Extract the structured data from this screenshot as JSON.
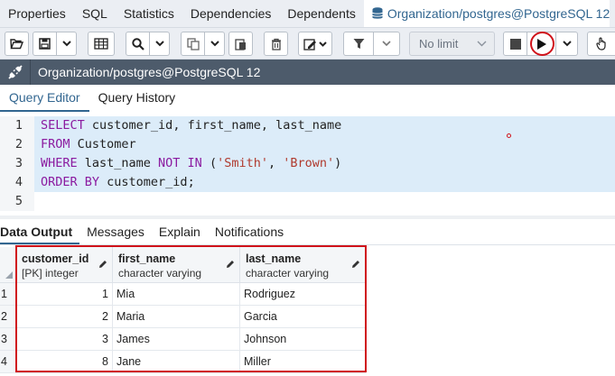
{
  "top_tabs": [
    {
      "label": "Properties"
    },
    {
      "label": "SQL"
    },
    {
      "label": "Statistics"
    },
    {
      "label": "Dependencies"
    },
    {
      "label": "Dependents"
    },
    {
      "label": "Organization/postgres@PostgreSQL 12",
      "active": true
    }
  ],
  "toolbar": {
    "limit_select": "No limit"
  },
  "connection": {
    "label": "Organization/postgres@PostgreSQL 12"
  },
  "editor_tabs": [
    {
      "label": "Query Editor",
      "active": true
    },
    {
      "label": "Query History"
    }
  ],
  "editor": {
    "line_numbers": [
      "1",
      "2",
      "3",
      "4",
      "5"
    ],
    "lines": [
      [
        {
          "t": "SELECT",
          "k": "kw"
        },
        {
          "t": " customer_id, first_name, last_name",
          "k": ""
        }
      ],
      [
        {
          "t": "FROM",
          "k": "kw"
        },
        {
          "t": " Customer",
          "k": ""
        }
      ],
      [
        {
          "t": "WHERE",
          "k": "kw"
        },
        {
          "t": " last_name ",
          "k": ""
        },
        {
          "t": "NOT IN",
          "k": "kw"
        },
        {
          "t": " (",
          "k": ""
        },
        {
          "t": "'Smith'",
          "k": "str"
        },
        {
          "t": ", ",
          "k": ""
        },
        {
          "t": "'Brown'",
          "k": "str"
        },
        {
          "t": ")",
          "k": ""
        }
      ],
      [
        {
          "t": "ORDER BY",
          "k": "kw"
        },
        {
          "t": " customer_id;",
          "k": ""
        }
      ],
      []
    ]
  },
  "result_tabs": [
    {
      "label": "Data Output",
      "active": true
    },
    {
      "label": "Messages"
    },
    {
      "label": "Explain"
    },
    {
      "label": "Notifications"
    }
  ],
  "grid": {
    "columns": [
      {
        "name": "customer_id",
        "type": "[PK] integer"
      },
      {
        "name": "first_name",
        "type": "character varying"
      },
      {
        "name": "last_name",
        "type": "character varying"
      }
    ],
    "rows": [
      {
        "n": "1",
        "cells": [
          "1",
          "Mia",
          "Rodriguez"
        ]
      },
      {
        "n": "2",
        "cells": [
          "2",
          "Maria",
          "Garcia"
        ]
      },
      {
        "n": "3",
        "cells": [
          "3",
          "James",
          "Johnson"
        ]
      },
      {
        "n": "4",
        "cells": [
          "8",
          "Jane",
          "Miller"
        ]
      }
    ]
  },
  "colors": {
    "accent": "#326690",
    "keyword": "#8b1ba0",
    "string": "#b03a2e",
    "annotation_red": "#d0121a",
    "connection_bar": "#4d5b6b"
  }
}
